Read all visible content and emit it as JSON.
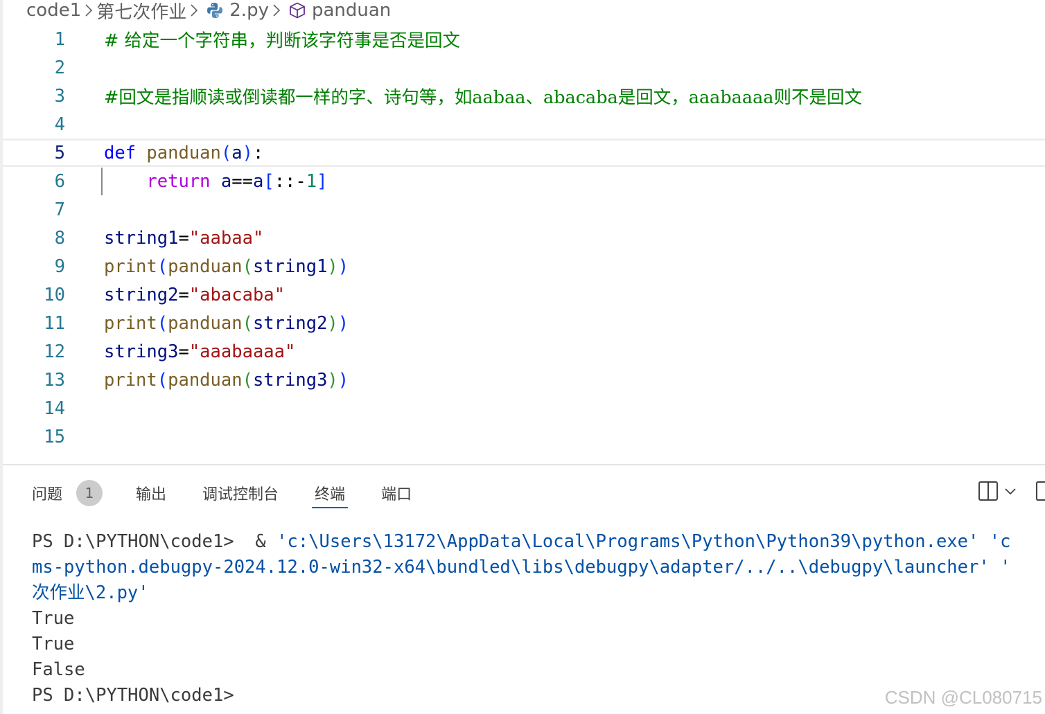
{
  "breadcrumb": {
    "items": [
      "code1",
      "第七次作业",
      "2.py",
      "panduan"
    ],
    "icons": [
      "chevron-right-icon",
      "python-file-icon",
      "method-cube-icon"
    ]
  },
  "editor": {
    "current_line": 5,
    "lines": [
      {
        "n": "1",
        "tokens": [
          {
            "t": "# 给定一个字符串，判断该字符事是否是回文",
            "c": "comment"
          }
        ]
      },
      {
        "n": "2",
        "tokens": []
      },
      {
        "n": "3",
        "tokens": [
          {
            "t": "#回文是指顺读或倒读都一样的字、诗句等，如aabaa、abacaba是回文，aaabaaaa则不是回文",
            "c": "comment"
          }
        ]
      },
      {
        "n": "4",
        "tokens": []
      },
      {
        "n": "5",
        "tokens": [
          {
            "t": "def",
            "c": "kw"
          },
          {
            "t": " ",
            "c": "op"
          },
          {
            "t": "panduan",
            "c": "fn"
          },
          {
            "t": "(",
            "c": "b1"
          },
          {
            "t": "a",
            "c": "var"
          },
          {
            "t": ")",
            "c": "b1"
          },
          {
            "t": ":",
            "c": "op"
          }
        ]
      },
      {
        "n": "6",
        "tokens": [
          {
            "t": "    ",
            "c": "op"
          },
          {
            "t": "return",
            "c": "ctrl"
          },
          {
            "t": " ",
            "c": "op"
          },
          {
            "t": "a",
            "c": "var"
          },
          {
            "t": "==",
            "c": "op"
          },
          {
            "t": "a",
            "c": "var"
          },
          {
            "t": "[",
            "c": "b1"
          },
          {
            "t": "::-",
            "c": "op"
          },
          {
            "t": "1",
            "c": "num"
          },
          {
            "t": "]",
            "c": "b1"
          }
        ]
      },
      {
        "n": "7",
        "tokens": []
      },
      {
        "n": "8",
        "tokens": [
          {
            "t": "string1",
            "c": "var"
          },
          {
            "t": "=",
            "c": "op"
          },
          {
            "t": "\"aabaa\"",
            "c": "str"
          }
        ]
      },
      {
        "n": "9",
        "tokens": [
          {
            "t": "print",
            "c": "fn"
          },
          {
            "t": "(",
            "c": "b1"
          },
          {
            "t": "panduan",
            "c": "fn"
          },
          {
            "t": "(",
            "c": "b2"
          },
          {
            "t": "string1",
            "c": "var"
          },
          {
            "t": ")",
            "c": "b2"
          },
          {
            "t": ")",
            "c": "b1"
          }
        ]
      },
      {
        "n": "10",
        "tokens": [
          {
            "t": "string2",
            "c": "var"
          },
          {
            "t": "=",
            "c": "op"
          },
          {
            "t": "\"abacaba\"",
            "c": "str"
          }
        ]
      },
      {
        "n": "11",
        "tokens": [
          {
            "t": "print",
            "c": "fn"
          },
          {
            "t": "(",
            "c": "b1"
          },
          {
            "t": "panduan",
            "c": "fn"
          },
          {
            "t": "(",
            "c": "b2"
          },
          {
            "t": "string2",
            "c": "var"
          },
          {
            "t": ")",
            "c": "b2"
          },
          {
            "t": ")",
            "c": "b1"
          }
        ]
      },
      {
        "n": "12",
        "tokens": [
          {
            "t": "string3",
            "c": "var"
          },
          {
            "t": "=",
            "c": "op"
          },
          {
            "t": "\"aaabaaaa\"",
            "c": "str"
          }
        ]
      },
      {
        "n": "13",
        "tokens": [
          {
            "t": "print",
            "c": "fn"
          },
          {
            "t": "(",
            "c": "b1"
          },
          {
            "t": "panduan",
            "c": "fn"
          },
          {
            "t": "(",
            "c": "b2"
          },
          {
            "t": "string3",
            "c": "var"
          },
          {
            "t": ")",
            "c": "b2"
          },
          {
            "t": ")",
            "c": "b1"
          }
        ]
      },
      {
        "n": "14",
        "tokens": []
      },
      {
        "n": "15",
        "tokens": []
      }
    ]
  },
  "panel": {
    "tabs": [
      {
        "label": "问题",
        "badge": "1",
        "active": false
      },
      {
        "label": "输出",
        "active": false
      },
      {
        "label": "调试控制台",
        "active": false
      },
      {
        "label": "终端",
        "active": true
      },
      {
        "label": "端口",
        "active": false
      }
    ],
    "actions": [
      "split-terminal-icon",
      "chevron-down-icon",
      "maximize-panel-icon"
    ]
  },
  "terminal": {
    "lines": [
      [
        {
          "t": "PS D:\\PYTHON\\code1> ",
          "c": "plain"
        },
        {
          "t": " & ",
          "c": "plain"
        },
        {
          "t": "'c:\\Users\\13172\\AppData\\Local\\Programs\\Python\\Python39\\python.exe'",
          "c": "str"
        },
        {
          "t": " 'c",
          "c": "str"
        }
      ],
      [
        {
          "t": "ms-python.debugpy-2024.12.0-win32-x64\\bundled\\libs\\debugpy\\adapter/../..\\debugpy\\launcher'",
          "c": "str"
        },
        {
          "t": " '",
          "c": "str"
        }
      ],
      [
        {
          "t": "次作业",
          "c": "str-cn"
        },
        {
          "t": "\\2.py'",
          "c": "str"
        }
      ],
      [
        {
          "t": "True",
          "c": "plain"
        }
      ],
      [
        {
          "t": "True",
          "c": "plain"
        }
      ],
      [
        {
          "t": "False",
          "c": "plain"
        }
      ],
      [
        {
          "t": "PS D:\\PYTHON\\code1> ",
          "c": "plain"
        }
      ]
    ]
  },
  "watermark": "CSDN @CL080715",
  "colors": {
    "comment": "#008000",
    "keyword": "#0000ff",
    "control": "#af00db",
    "function": "#795e26",
    "variable": "#001080",
    "string": "#a31515",
    "number": "#098658",
    "line_number": "#237893",
    "terminal_string": "#0451a5",
    "tab_underline": "#005fb8"
  }
}
